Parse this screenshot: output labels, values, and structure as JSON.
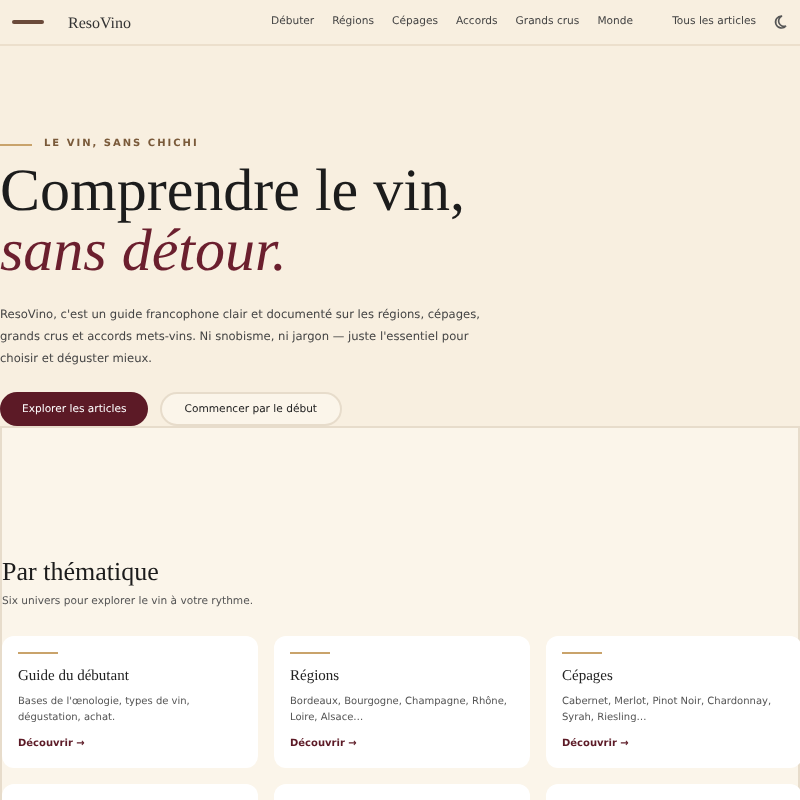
{
  "header": {
    "brand": "ResoVino",
    "nav": [
      {
        "label": "Débuter",
        "selected": false
      },
      {
        "label": "Régions",
        "selected": false
      },
      {
        "label": "Cépages",
        "selected": false
      },
      {
        "label": "Accords",
        "selected": false
      },
      {
        "label": "Grands crus",
        "selected": false
      },
      {
        "label": "Monde",
        "selected": false
      }
    ],
    "all_articles": "Tous les articles"
  },
  "hero": {
    "eyebrow": "LE VIN, SANS CHICHI",
    "title_line1": "Comprendre le vin,",
    "title_line2": "sans détour.",
    "text": "ResoVino, c'est un guide francophone clair et documenté sur les régions, cépages, grands crus et accords mets-vins. Ni snobisme, ni jargon — juste l'essentiel pour choisir et déguster mieux.",
    "buttons": [
      {
        "label": "Explorer les articles",
        "kind": "primary"
      },
      {
        "label": "Commencer par le début",
        "kind": "secondary"
      }
    ]
  },
  "section": {
    "title": "Par thématique",
    "subtitle": "Six univers pour explorer le vin à votre rythme.",
    "cards": [
      {
        "title": "Guide du débutant",
        "text": "Bases de l'œnologie, types de vin, dégustation, achat.",
        "link": "Découvrir →"
      },
      {
        "title": "Régions",
        "text": "Bordeaux, Bourgogne, Champagne, Rhône, Loire, Alsace…",
        "link": "Découvrir →"
      },
      {
        "title": "Cépages",
        "text": "Cabernet, Merlot, Pinot Noir, Chardonnay, Syrah, Riesling…",
        "link": "Découvrir →"
      }
    ]
  }
}
